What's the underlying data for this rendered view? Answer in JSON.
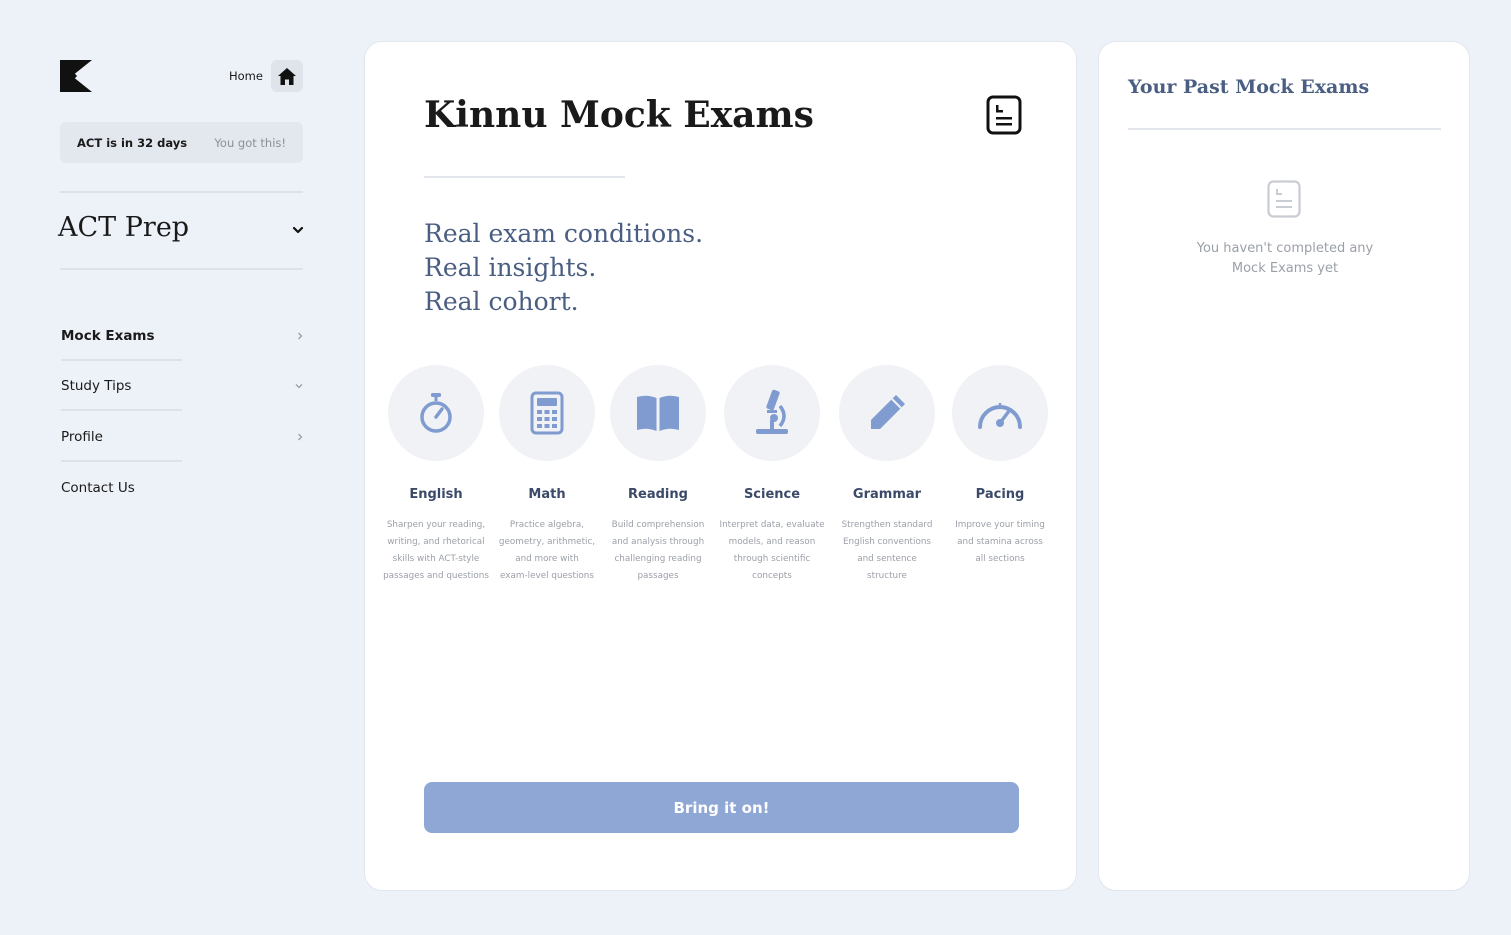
{
  "sidebar": {
    "logo": "kinnu-k-logo",
    "home_label": "Home",
    "home_icon": "home-icon",
    "countdown": {
      "days_text": "ACT is in 32 days",
      "encouragement": "You got this!"
    },
    "prep_title": "ACT Prep",
    "nav": [
      {
        "label": "Mock Exams",
        "active": true,
        "icon": "chevron-right-icon"
      },
      {
        "label": "Study Tips",
        "active": false,
        "icon": "chevron-down-icon"
      },
      {
        "label": "Profile",
        "active": false,
        "icon": "chevron-right-icon"
      },
      {
        "label": "Contact Us",
        "active": false,
        "icon": ""
      }
    ]
  },
  "main": {
    "title": "Kinnu Mock Exams",
    "tagline": [
      "Real exam conditions.",
      "Real insights.",
      "Real cohort."
    ],
    "subjects": [
      {
        "name": "English",
        "icon": "stopwatch-icon",
        "desc_lines": [
          "Sharpen your reading,",
          "writing, and rhetorical",
          "skills with ACT-style",
          "passages and questions"
        ]
      },
      {
        "name": "Math",
        "icon": "calculator-icon",
        "desc_lines": [
          "Practice algebra,",
          "geometry, arithmetic,",
          "and more with",
          "exam-level questions"
        ]
      },
      {
        "name": "Reading",
        "icon": "book-icon",
        "desc_lines": [
          "Build comprehension",
          "and analysis through",
          "challenging reading",
          "passages"
        ]
      },
      {
        "name": "Science",
        "icon": "microscope-icon",
        "desc_lines": [
          "Interpret data, evaluate",
          "models, and reason",
          "through scientific",
          "concepts"
        ]
      },
      {
        "name": "Grammar",
        "icon": "pencil-icon",
        "desc_lines": [
          "Strengthen standard",
          "English conventions",
          "and sentence",
          "structure"
        ]
      },
      {
        "name": "Pacing",
        "icon": "speedometer-icon",
        "desc_lines": [
          "Improve your timing",
          "and stamina across",
          "all sections"
        ]
      }
    ],
    "cta_label": "Bring it on!"
  },
  "past": {
    "title": "Your Past Mock Exams",
    "empty_icon": "document-icon",
    "empty_lines": [
      "You haven't completed any",
      "Mock Exams yet"
    ]
  },
  "colors": {
    "background": "#edf1f8",
    "accent": "#8fa7d4",
    "icon_blue": "#7f9bd0",
    "heading_navy": "#4a5e82"
  }
}
